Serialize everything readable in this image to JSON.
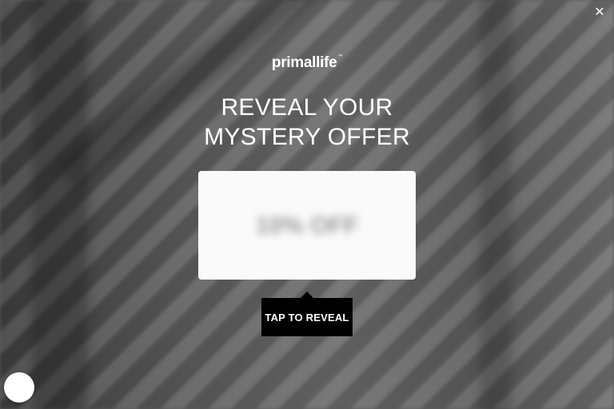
{
  "modal": {
    "close_icon": "close-icon",
    "brand": {
      "name": "primallife",
      "tm": "™"
    },
    "headline": {
      "line1": "REVEAL YOUR",
      "line2": "MYSTERY OFFER"
    },
    "offer": {
      "hidden_text": "10% OFF"
    },
    "reveal_button": {
      "label": "TAP TO REVEAL"
    },
    "chat_launcher_icon": "chat-launcher-icon"
  },
  "colors": {
    "button_bg": "#000000",
    "card_bg": "#fafafa",
    "text": "#ffffff"
  }
}
